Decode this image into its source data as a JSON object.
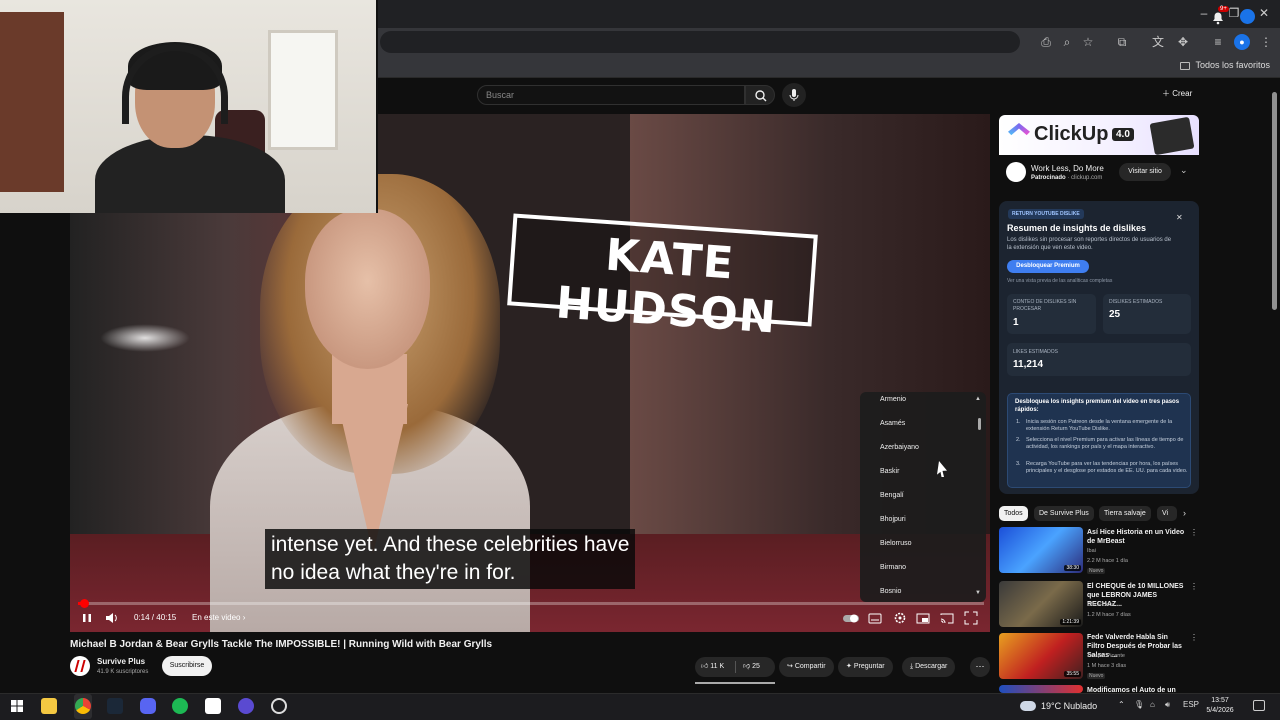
{
  "browser": {
    "favorites_label": "Todos los favoritos"
  },
  "youtube": {
    "search_placeholder": "Buscar",
    "create_label": "Crear",
    "notifications_badge": "9+"
  },
  "video": {
    "overlay_title": "KATE HUDSON",
    "subtitle_line1": "intense yet. And these celebrities have",
    "subtitle_line2": "no idea what they're in for.",
    "current_time": "0:14 / 40:15",
    "chapter_label": "En este video",
    "progress_fraction": 0.006,
    "title": "Michael B Jordan & Bear Grylls Tackle The IMPOSSIBLE! | Running Wild with Bear Grylls",
    "channel_name": "Survive Plus",
    "channel_subs": "41.9 K suscriptores",
    "subscribe_label": "Suscribirse",
    "likes": "11 K",
    "dislikes": "25",
    "share_label": "Compartir",
    "ask_label": "Preguntar",
    "download_label": "Descargar"
  },
  "language_menu": {
    "items": [
      "Armenio",
      "Asamés",
      "Azerbaiyano",
      "Baskir",
      "Bengalí",
      "Bhojpuri",
      "Bielorruso",
      "Birmano",
      "Bosnio"
    ]
  },
  "ad": {
    "brand": "ClickUp",
    "version": "4.0",
    "headline": "Work Less, Do More",
    "sponsored": "Patrocinado",
    "domain": "clickup.com",
    "cta": "Visitar sitio"
  },
  "dislike_panel": {
    "badge": "RETURN YOUTUBE DISLIKE",
    "title": "Resumen de insights de dislikes",
    "description": "Los dislikes sin procesar son reportes directos de usuarios de la extensión que ven este video.",
    "unlock_label": "Desbloquear Premium",
    "preview_note": "Ver una vista previa de las analíticas completas",
    "stat1_label": "CONTEO DE DISLIKES SIN PROCESAR",
    "stat1_value": "1",
    "stat2_label": "DISLIKES ESTIMADOS",
    "stat2_value": "25",
    "stat3_label": "LIKES ESTIMADOS",
    "stat3_value": "11,214",
    "promo_heading": "Desbloquea los insights premium del video en tres pasos rápidos:",
    "steps": [
      "Inicia sesión con Patreon desde la ventana emergente de la extensión Return YouTube Dislike.",
      "Selecciona el nivel Premium para activar las líneas de tiempo de actividad, los rankings por país y el mapa interactivo.",
      "Recarga YouTube para ver las tendencias por hora, los países principales y el desglose por estados de EE. UU. para cada video."
    ]
  },
  "chips": [
    "Todos",
    "De Survive Plus",
    "Tierra salvaje",
    "Vi"
  ],
  "recommendations": [
    {
      "title": "Así Hice Historia en un Video de MrBeast",
      "channel": "Ibai",
      "meta": "2.2 M  hace 1 día",
      "badge": "Nuevo",
      "duration": "38:30"
    },
    {
      "title": "El CHEQUE de 10 MILLONES que LEBRON JAMES RECHAZ...",
      "channel": "Dieck Docs",
      "meta": "1.2 M  hace 7 días",
      "badge": "",
      "duration": "1:21:39"
    },
    {
      "title": "Fede Valverde Habla Sin Filtro Después de Probar las Salsas ...",
      "channel": "Terapia Picante",
      "meta": "1 M  hace 3 días",
      "badge": "Nuevo",
      "duration": "35:55"
    },
    {
      "title": "Modificamos el Auto de un",
      "channel": "",
      "meta": "",
      "badge": "",
      "duration": ""
    }
  ],
  "taskbar": {
    "weather": "19°C  Nublado",
    "lang": "ESP",
    "time": "13:57",
    "date": "5/4/2026"
  },
  "colors": {
    "accent_red": "#ff0000",
    "background": "#0f0f0f",
    "panel_blue": "#1c2430",
    "unlock_blue": "#3f7ef0"
  }
}
